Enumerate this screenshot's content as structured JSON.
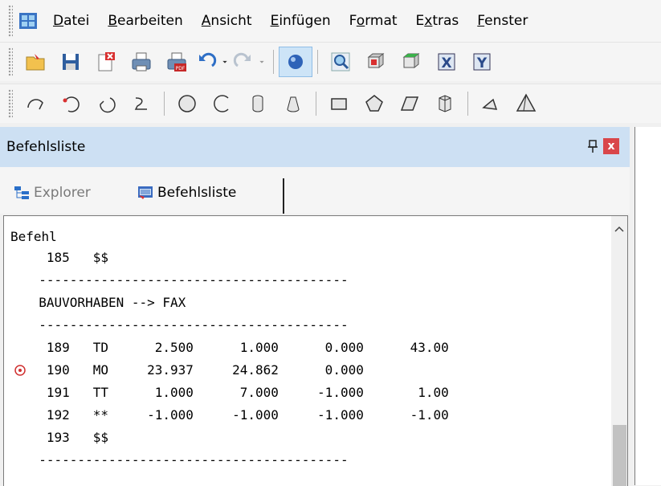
{
  "menu": {
    "items": [
      {
        "pre": "",
        "acc": "D",
        "post": "atei"
      },
      {
        "pre": "",
        "acc": "B",
        "post": "earbeiten"
      },
      {
        "pre": "",
        "acc": "A",
        "post": "nsicht"
      },
      {
        "pre": "",
        "acc": "E",
        "post": "infügen"
      },
      {
        "pre": "F",
        "acc": "o",
        "post": "rmat"
      },
      {
        "pre": "E",
        "acc": "x",
        "post": "tras"
      },
      {
        "pre": "",
        "acc": "F",
        "post": "enster"
      }
    ]
  },
  "panel": {
    "title": "Befehlsliste",
    "close_glyph": "x",
    "tabs": [
      {
        "label": "Explorer"
      },
      {
        "label": "Befehlsliste"
      }
    ]
  },
  "list": {
    "header": "Befehl",
    "rows": [
      {
        "text": "   185   $$"
      },
      {
        "text": "  ----------------------------------------"
      },
      {
        "text": "  BAUVORHABEN --> FAX"
      },
      {
        "text": "  ----------------------------------------"
      },
      {
        "text": "   189   TD      2.500      1.000      0.000      43.00"
      },
      {
        "text": "   190   MO     23.937     24.862      0.000",
        "marker": true
      },
      {
        "text": "   191   TT      1.000      7.000     -1.000       1.00"
      },
      {
        "text": "   192   **     -1.000     -1.000     -1.000      -1.00"
      },
      {
        "text": "   193   $$"
      },
      {
        "text": "  ----------------------------------------"
      }
    ]
  },
  "colors": {
    "panel_title_bg": "#cde0f3",
    "close_button": "#d9464a",
    "active_tool_bg": "#cde4f7",
    "marker": "#d03030"
  }
}
